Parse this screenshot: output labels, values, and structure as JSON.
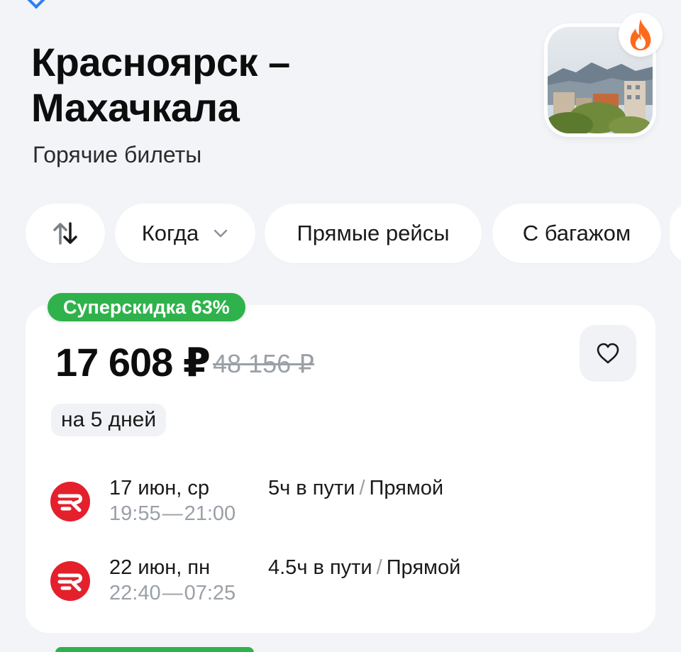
{
  "header": {
    "title_line1": "Красноярск –",
    "title_line2": "Махачкала",
    "subtitle": "Горячие билеты"
  },
  "icons": {
    "back": "chevron-left-icon",
    "hot": "fire-icon",
    "swap": "swap-arrows-icon",
    "dropdown": "chevron-down-icon",
    "favorite": "heart-icon",
    "airline": "airline-logo-icon"
  },
  "filters": {
    "when_label": "Когда",
    "direct_label": "Прямые рейсы",
    "baggage_label": "С багажом"
  },
  "offer": {
    "badge": "Суперскидка 63%",
    "price": "17 608 ₽",
    "old_price": "48 156 ₽",
    "duration": "на 5 дней",
    "legs": [
      {
        "date": "17 июн, ср",
        "depart": "19:55",
        "arrive": "21:00",
        "travel_time": "5ч в пути",
        "stops": "Прямой"
      },
      {
        "date": "22 июн, пн",
        "depart": "22:40",
        "arrive": "07:25",
        "travel_time": "4.5ч в пути",
        "stops": "Прямой"
      }
    ]
  },
  "colors": {
    "accent": "#2f7cf6",
    "discount": "#2fb24b",
    "hot": "#ff6a1a",
    "airline": "#e3202c",
    "background": "#f2f4f7"
  }
}
